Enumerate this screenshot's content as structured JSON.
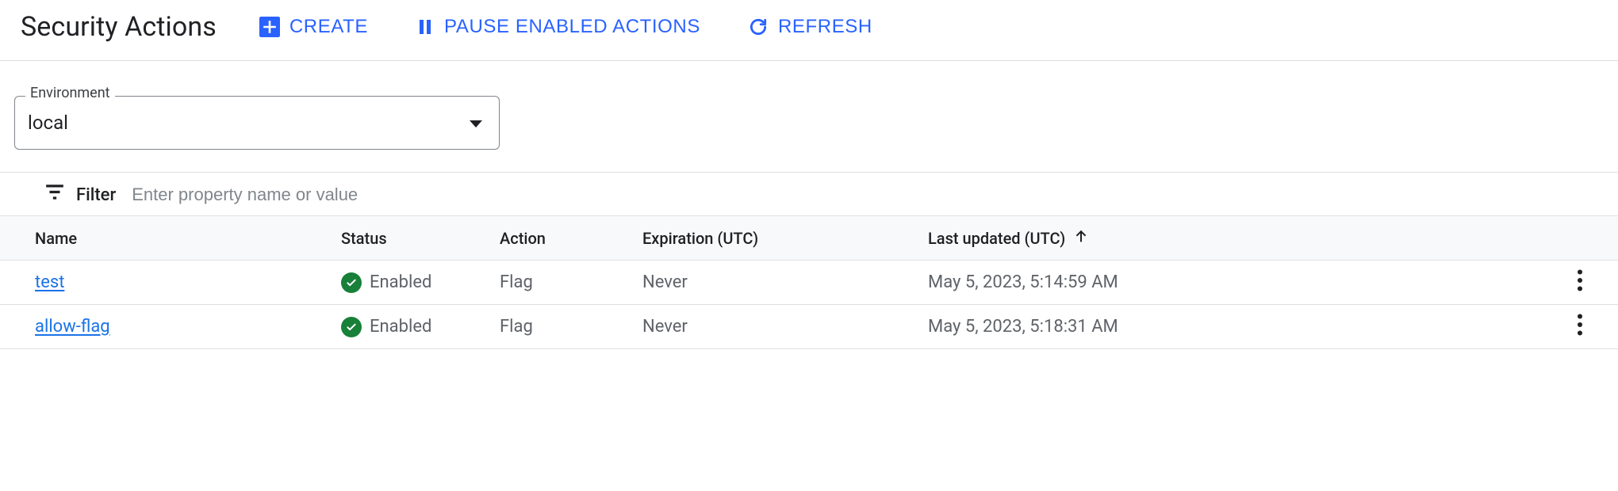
{
  "page": {
    "title": "Security Actions"
  },
  "actions": {
    "create": "CREATE",
    "pause": "PAUSE ENABLED ACTIONS",
    "refresh": "REFRESH"
  },
  "environment": {
    "label": "Environment",
    "value": "local"
  },
  "filter": {
    "label": "Filter",
    "placeholder": "Enter property name or value"
  },
  "table": {
    "columns": {
      "name": "Name",
      "status": "Status",
      "action": "Action",
      "expiration": "Expiration (UTC)",
      "last_updated": "Last updated (UTC)"
    },
    "sort": {
      "column": "last_updated",
      "direction": "asc"
    },
    "rows": [
      {
        "name": "test",
        "status_label": "Enabled",
        "status_state": "enabled",
        "action": "Flag",
        "expiration": "Never",
        "last_updated": "May 5, 2023, 5:14:59 AM"
      },
      {
        "name": "allow-flag",
        "status_label": "Enabled",
        "status_state": "enabled",
        "action": "Flag",
        "expiration": "Never",
        "last_updated": "May 5, 2023, 5:18:31 AM"
      }
    ]
  },
  "colors": {
    "accent": "#1a73e8",
    "success": "#188038"
  }
}
